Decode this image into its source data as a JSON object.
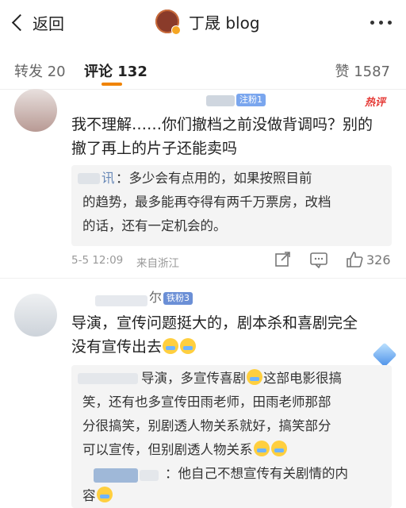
{
  "header": {
    "back_label": "返回",
    "title": "丁晟 blog"
  },
  "tabs": {
    "repost": "转发 20",
    "comment": "评论 132",
    "like": "赞 1587"
  },
  "comments": [
    {
      "badge": "注粉1",
      "hot_tag": "热评",
      "text_line1": "我不理解……你们撤档之前没做背调吗？别的",
      "text_line2": "撤了再上的片子还能卖吗",
      "reply_line1": "：多少会有点用的，如果按照目前",
      "reply_line2": "的趋势，最多能再夺得有两千万票房，改档",
      "reply_line3": "的话，还有一定机会的。",
      "reply_name_tail": "讯",
      "time": "5-5 12:09",
      "location": "来自浙江",
      "likes": "326"
    },
    {
      "name_tail": "尔",
      "badge": "铁粉3",
      "text_line1": "导演，宣传问题挺大的，剧本杀和喜剧完全",
      "text_line2": "没有宣传出去",
      "reply1_line1": "导演，多宣传喜剧",
      "reply1_line1b": "这部电影很搞",
      "reply1_line2": "笑，还有也多宣传田雨老师，田雨老师那部",
      "reply1_line3": "分很搞笑，别剧透人物关系就好，搞笑部分",
      "reply1_line4": "可以宣传，但别剧透人物关系",
      "reply2_line1": "：他自己不想宣传有关剧情的内",
      "reply2_line2": "容"
    }
  ],
  "icons": {
    "back": "chevron-left-icon",
    "more": "more-dots-icon",
    "share": "share-icon",
    "reply": "comment-icon",
    "like": "thumbs-up-icon"
  }
}
